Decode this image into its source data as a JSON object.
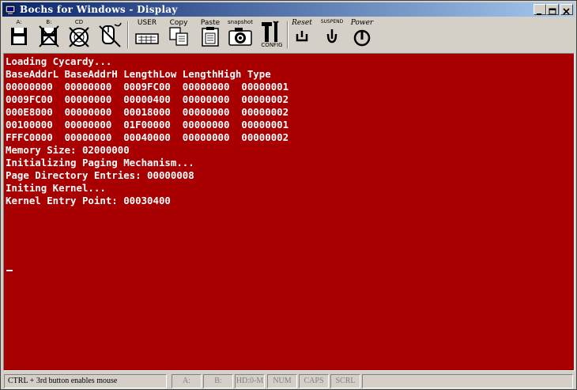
{
  "window": {
    "title": "Bochs for Windows - Display"
  },
  "toolbar": {
    "floppy_a": "A:",
    "floppy_b": "B:",
    "cdrom": "CD",
    "user": "USER",
    "copy": "Copy",
    "paste": "Paste",
    "snapshot": "snapshot",
    "config": "CONFIG",
    "reset": "Reset",
    "suspend": "SUSPEND",
    "power": "Power"
  },
  "terminal": {
    "lines": [
      "Loading Cycardy...",
      "BaseAddrL BaseAddrH LengthLow LengthHigh Type",
      "00000000  00000000  0009FC00  00000000  00000001",
      "0009FC00  00000000  00000400  00000000  00000002",
      "000E8000  00000000  00018000  00000000  00000002",
      "00100000  00000000  01F00000  00000000  00000001",
      "FFFC0000  00000000  00040000  00000000  00000002",
      "Memory Size: 02000000",
      "Initializing Paging Mechanism...",
      "Page Directory Entries: 00000008",
      "Initing Kernel...",
      "Kernel Entry Point: 00030400"
    ]
  },
  "status": {
    "hint": "CTRL + 3rd button enables mouse",
    "a": "A:",
    "b": "B:",
    "hd": "HD:0-M",
    "num": "NUM",
    "caps": "CAPS",
    "scrl": "SCRL"
  },
  "colors": {
    "screen_bg": "#a80000",
    "text": "#ffffff",
    "titlebar": "#0a246a"
  }
}
